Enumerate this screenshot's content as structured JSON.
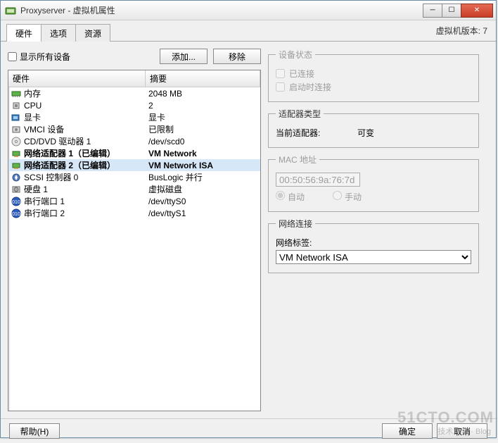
{
  "window": {
    "title": "Proxyserver - 虚拟机属性"
  },
  "tabs": {
    "hardware": "硬件",
    "options": "选项",
    "resources": "资源"
  },
  "version_label": "虚拟机版本: 7",
  "controls": {
    "show_all_devices": "显示所有设备",
    "add": "添加...",
    "remove": "移除"
  },
  "headers": {
    "hardware": "硬件",
    "summary": "摘要"
  },
  "rows": [
    {
      "name": "内存",
      "summary": "2048 MB",
      "icon": "memory"
    },
    {
      "name": "CPU",
      "summary": "2",
      "icon": "cpu"
    },
    {
      "name": "显卡",
      "summary": "显卡",
      "icon": "video"
    },
    {
      "name": "VMCI 设备",
      "summary": "已限制",
      "icon": "vmci"
    },
    {
      "name": "CD/DVD 驱动器 1",
      "summary": "/dev/scd0",
      "icon": "cd"
    },
    {
      "name": "网络适配器 1（已编辑）",
      "summary": "VM Network",
      "icon": "nic",
      "bold": true
    },
    {
      "name": "网络适配器 2（已编辑）",
      "summary": "VM Network ISA",
      "icon": "nic",
      "bold": true,
      "selected": true
    },
    {
      "name": "SCSI 控制器 0",
      "summary": "BusLogic 并行",
      "icon": "scsi"
    },
    {
      "name": "硬盘 1",
      "summary": "虚拟磁盘",
      "icon": "disk"
    },
    {
      "name": "串行端口 1",
      "summary": "/dev/ttyS0",
      "icon": "serial"
    },
    {
      "name": "串行端口 2",
      "summary": "/dev/ttyS1",
      "icon": "serial"
    }
  ],
  "device_status": {
    "legend": "设备状态",
    "connected": "已连接",
    "connect_at_power_on": "启动时连接"
  },
  "adapter_type": {
    "legend": "适配器类型",
    "current_label": "当前适配器:",
    "current_value": "可变"
  },
  "mac": {
    "legend": "MAC 地址",
    "value": "00:50:56:9a:76:7d",
    "auto": "自动",
    "manual": "手动"
  },
  "network": {
    "legend": "网络连接",
    "label": "网络标签:",
    "selected": "VM Network ISA"
  },
  "footer": {
    "help": "帮助(H)",
    "ok": "确定",
    "cancel": "取消"
  },
  "watermark1": "51CTO.COM",
  "watermark2": "技术博客 · Blog"
}
